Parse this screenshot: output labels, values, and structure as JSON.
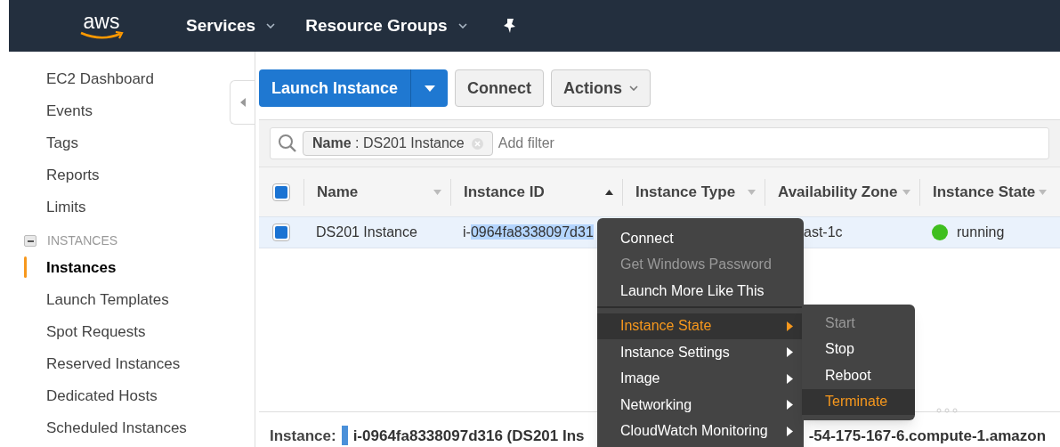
{
  "topbar": {
    "logo": "aws",
    "menus": [
      {
        "label": "Services"
      },
      {
        "label": "Resource Groups"
      }
    ]
  },
  "sidebar": {
    "items": [
      {
        "label": "EC2 Dashboard",
        "selected": false
      },
      {
        "label": "Events",
        "selected": false
      },
      {
        "label": "Tags",
        "selected": false
      },
      {
        "label": "Reports",
        "selected": false
      },
      {
        "label": "Limits",
        "selected": false
      }
    ],
    "section": {
      "title": "INSTANCES",
      "expanded": true,
      "items": [
        {
          "label": "Instances",
          "selected": true
        },
        {
          "label": "Launch Templates",
          "selected": false
        },
        {
          "label": "Spot Requests",
          "selected": false
        },
        {
          "label": "Reserved Instances",
          "selected": false
        },
        {
          "label": "Dedicated Hosts",
          "selected": false
        },
        {
          "label": "Scheduled Instances",
          "selected": false
        }
      ]
    }
  },
  "toolbar": {
    "launch": "Launch Instance",
    "connect": "Connect",
    "actions": "Actions"
  },
  "filter": {
    "token": "**Name** : DS201 Instance",
    "placeholder": "Add filter"
  },
  "table": {
    "all_checked": true,
    "columns": [
      {
        "label": "Name",
        "sorted": false
      },
      {
        "label": "Instance ID",
        "sorted": true
      },
      {
        "label": "Instance Type",
        "sorted": false
      },
      {
        "label": "Availability Zone",
        "sorted": false
      },
      {
        "label": "Instance State",
        "sorted": false
      }
    ],
    "rows": [
      {
        "checked": true,
        "selected": true,
        "name": "DS201 Instance",
        "id_plain": "i-",
        "id_highlighted": "0964fa8338097d31",
        "zone": "ast-1c",
        "state": "running",
        "color": "#3fbf1f"
      }
    ]
  },
  "details": {
    "label": "Instance:",
    "left": "i-0964fa8338097d316 (DS201 Ins",
    "right": "-54-175-167-6.compute-1.amazon"
  },
  "context_menu": {
    "items": [
      {
        "label": "Connect",
        "disabled": false,
        "selected": false,
        "submenu": false
      },
      {
        "label": "Get Windows Password",
        "disabled": true,
        "selected": false,
        "submenu": false
      },
      {
        "label": "Launch More Like This",
        "disabled": false,
        "selected": false,
        "submenu": false,
        "separator_after": true
      },
      {
        "label": "Instance State",
        "disabled": false,
        "selected": true,
        "submenu": true
      },
      {
        "label": "Instance Settings",
        "disabled": false,
        "selected": false,
        "submenu": true
      },
      {
        "label": "Image",
        "disabled": false,
        "selected": false,
        "submenu": true
      },
      {
        "label": "Networking",
        "disabled": false,
        "selected": false,
        "submenu": true
      },
      {
        "label": "CloudWatch Monitoring",
        "disabled": false,
        "selected": false,
        "submenu": true
      }
    ],
    "submenu": [
      {
        "label": "Start",
        "disabled": true,
        "selected": false
      },
      {
        "label": "Stop",
        "disabled": false,
        "selected": false
      },
      {
        "label": "Reboot",
        "disabled": false,
        "selected": false
      },
      {
        "label": "Terminate",
        "disabled": false,
        "selected": true
      }
    ]
  }
}
